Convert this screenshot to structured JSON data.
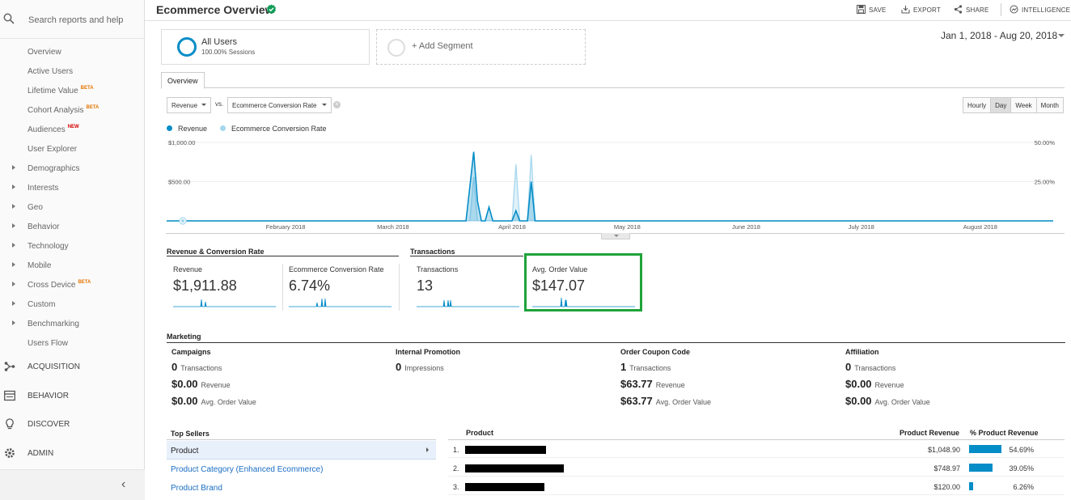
{
  "sidebar": {
    "search_label": "Search reports and help",
    "items": [
      {
        "label": "Overview",
        "tag": "",
        "expandable": false
      },
      {
        "label": "Active Users",
        "tag": "",
        "expandable": false
      },
      {
        "label": "Lifetime Value",
        "tag": "BETA",
        "expandable": false
      },
      {
        "label": "Cohort Analysis",
        "tag": "BETA",
        "expandable": false
      },
      {
        "label": "Audiences",
        "tag": "NEW",
        "expandable": false
      },
      {
        "label": "User Explorer",
        "tag": "",
        "expandable": false
      },
      {
        "label": "Demographics",
        "tag": "",
        "expandable": true
      },
      {
        "label": "Interests",
        "tag": "",
        "expandable": true
      },
      {
        "label": "Geo",
        "tag": "",
        "expandable": true
      },
      {
        "label": "Behavior",
        "tag": "",
        "expandable": true
      },
      {
        "label": "Technology",
        "tag": "",
        "expandable": true
      },
      {
        "label": "Mobile",
        "tag": "",
        "expandable": true
      },
      {
        "label": "Cross Device",
        "tag": "BETA",
        "expandable": true
      },
      {
        "label": "Custom",
        "tag": "",
        "expandable": true
      },
      {
        "label": "Benchmarking",
        "tag": "",
        "expandable": true
      },
      {
        "label": "Users Flow",
        "tag": "",
        "expandable": false
      }
    ],
    "main_nav": [
      {
        "label": "ACQUISITION",
        "icon": "acquisition-icon"
      },
      {
        "label": "BEHAVIOR",
        "icon": "behavior-icon"
      },
      {
        "label": "DISCOVER",
        "icon": "discover-icon"
      },
      {
        "label": "ADMIN",
        "icon": "admin-gear-icon"
      }
    ],
    "collapse_glyph": "‹"
  },
  "header": {
    "title": "Ecommerce Overview",
    "actions": {
      "save": "SAVE",
      "export": "EXPORT",
      "share": "SHARE",
      "intelligence": "INTELLIGENCE"
    }
  },
  "segments": {
    "active": {
      "name": "All Users",
      "detail": "100.00% Sessions"
    },
    "add": "+ Add Segment"
  },
  "date_range": "Jan 1, 2018 - Aug 20, 2018",
  "tabs": [
    "Overview"
  ],
  "controls": {
    "metric1": "Revenue",
    "vs": "vs.",
    "metric2": "Ecommerce Conversion Rate",
    "time_buttons": [
      "Hourly",
      "Day",
      "Week",
      "Month"
    ],
    "active_time": "Day"
  },
  "chart_data": {
    "type": "line",
    "series": [
      {
        "name": "Revenue",
        "color": "#058dc7",
        "axis": "left",
        "points": [
          [
            "2018-01-01",
            0
          ],
          [
            "2018-03-20",
            0
          ],
          [
            "2018-03-21",
            430
          ],
          [
            "2018-03-22",
            880
          ],
          [
            "2018-03-23",
            250
          ],
          [
            "2018-03-24",
            0
          ],
          [
            "2018-03-25",
            0
          ],
          [
            "2018-03-26",
            175
          ],
          [
            "2018-03-27",
            0
          ],
          [
            "2018-04-01",
            0
          ],
          [
            "2018-04-02",
            130
          ],
          [
            "2018-04-03",
            0
          ],
          [
            "2018-04-05",
            0
          ],
          [
            "2018-04-06",
            500
          ],
          [
            "2018-04-07",
            0
          ],
          [
            "2018-08-20",
            0
          ]
        ]
      },
      {
        "name": "Ecommerce Conversion Rate",
        "color": "#a6d7ee",
        "axis": "right",
        "points": [
          [
            "2018-01-01",
            0
          ],
          [
            "2018-03-21",
            0
          ],
          [
            "2018-03-22",
            28
          ],
          [
            "2018-03-23",
            0
          ],
          [
            "2018-04-01",
            0
          ],
          [
            "2018-04-02",
            36
          ],
          [
            "2018-04-03",
            0
          ],
          [
            "2018-04-05",
            0
          ],
          [
            "2018-04-06",
            42
          ],
          [
            "2018-04-07",
            0
          ],
          [
            "2018-08-20",
            0
          ]
        ]
      }
    ],
    "x_ticks": [
      [
        "2018-02-01",
        "February 2018"
      ],
      [
        "2018-03-01",
        "March 2018"
      ],
      [
        "2018-04-01",
        "April 2018"
      ],
      [
        "2018-05-01",
        "May 2018"
      ],
      [
        "2018-06-01",
        "June 2018"
      ],
      [
        "2018-07-01",
        "July 2018"
      ],
      [
        "2018-08-01",
        "August 2018"
      ]
    ],
    "x_range": [
      "2018-01-01",
      "2018-08-20"
    ],
    "y_left": {
      "ticks": [
        [
          "500",
          "$500.00"
        ],
        [
          "1000",
          "$1,000.00"
        ]
      ],
      "range": [
        0,
        1000
      ]
    },
    "y_right": {
      "ticks": [
        [
          "25",
          "25.00%"
        ],
        [
          "50",
          "50.00%"
        ]
      ],
      "range": [
        0,
        50
      ]
    },
    "grid": true,
    "legend": "top-left"
  },
  "revenue_section": {
    "title": "Revenue & Conversion Rate",
    "metrics": [
      {
        "label": "Revenue",
        "value": "$1,911.88"
      },
      {
        "label": "Ecommerce Conversion Rate",
        "value": "6.74%"
      }
    ]
  },
  "transactions_section": {
    "title": "Transactions",
    "metrics": [
      {
        "label": "Transactions",
        "value": "13"
      },
      {
        "label": "Avg. Order Value",
        "value": "$147.07"
      }
    ]
  },
  "marketing": {
    "title": "Marketing",
    "columns": [
      {
        "title": "Campaigns",
        "lines": [
          {
            "value": "0",
            "label": "Transactions"
          },
          {
            "value": "$0.00",
            "label": "Revenue"
          },
          {
            "value": "$0.00",
            "label": "Avg. Order Value"
          }
        ]
      },
      {
        "title": "Internal Promotion",
        "lines": [
          {
            "value": "0",
            "label": "Impressions"
          }
        ]
      },
      {
        "title": "Order Coupon Code",
        "lines": [
          {
            "value": "1",
            "label": "Transactions"
          },
          {
            "value": "$63.77",
            "label": "Revenue"
          },
          {
            "value": "$63.77",
            "label": "Avg. Order Value"
          }
        ]
      },
      {
        "title": "Affiliation",
        "lines": [
          {
            "value": "0",
            "label": "Transactions"
          },
          {
            "value": "$0.00",
            "label": "Revenue"
          },
          {
            "value": "$0.00",
            "label": "Avg. Order Value"
          }
        ]
      }
    ]
  },
  "top_sellers": {
    "title": "Top Sellers",
    "items": [
      "Product",
      "Product Category (Enhanced Ecommerce)",
      "Product Brand"
    ],
    "active": "Product"
  },
  "product_table": {
    "headers": {
      "product": "Product",
      "revenue": "Product Revenue",
      "pct": "% Product Revenue"
    },
    "rows": [
      {
        "rank": "1.",
        "revenue": "$1,048.90",
        "pct": "54.69%",
        "share": 0.5469
      },
      {
        "rank": "2.",
        "revenue": "$748.97",
        "pct": "39.05%",
        "share": 0.3905
      },
      {
        "rank": "3.",
        "revenue": "$120.00",
        "pct": "6.26%",
        "share": 0.0626
      }
    ]
  }
}
